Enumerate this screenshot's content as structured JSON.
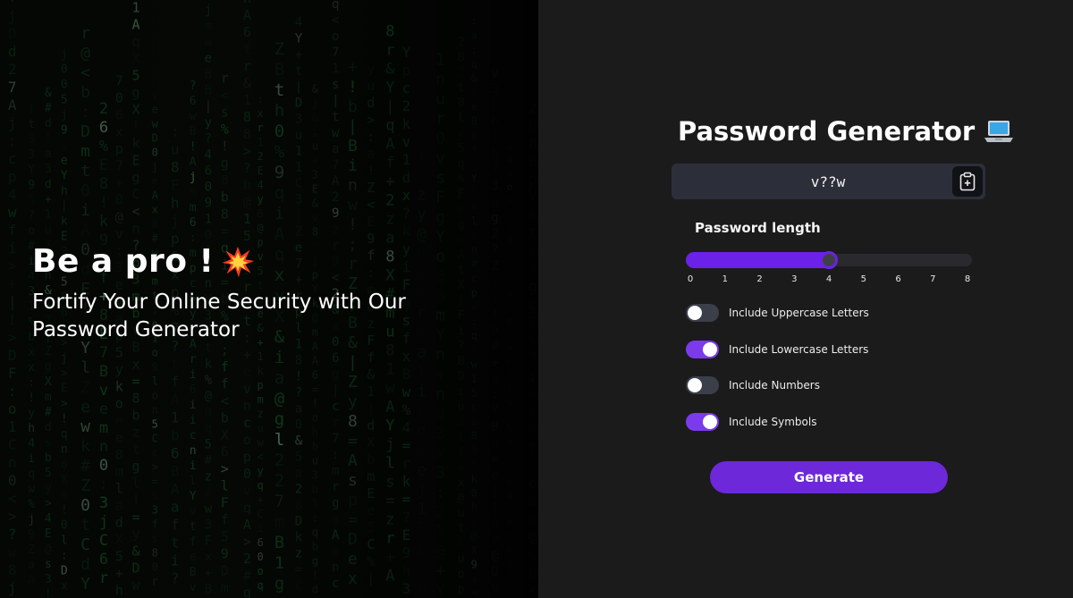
{
  "hero": {
    "title": "Be a pro !",
    "subtitle": "Fortify Your Online Security with Our Password Generator"
  },
  "generator": {
    "title": "Password Generator",
    "password": "v??w",
    "length_label": "Password length",
    "length_value": 4,
    "length_min": 0,
    "length_max": 8,
    "ticks": [
      "0",
      "1",
      "2",
      "3",
      "4",
      "5",
      "6",
      "7",
      "8"
    ],
    "options": [
      {
        "label": "Include Uppercase Letters",
        "checked": false
      },
      {
        "label": "Include Lowercase Letters",
        "checked": true
      },
      {
        "label": "Include Numbers",
        "checked": false
      },
      {
        "label": "Include Symbols",
        "checked": true
      }
    ],
    "generate_label": "Generate"
  },
  "colors": {
    "accent": "#6d28d9",
    "toggle_on": "#7c3aed",
    "toggle_off": "#3b3f4a",
    "matrix_green": "#1f8a3a"
  },
  "icons": {
    "hero": "collision-icon",
    "title": "laptop-icon",
    "copy": "clipboard-plus-icon"
  }
}
